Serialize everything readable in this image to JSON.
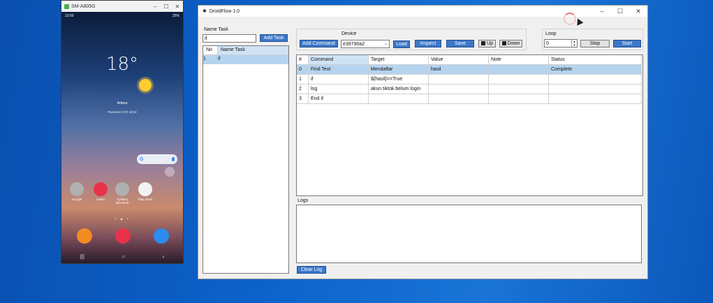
{
  "phone": {
    "window_title": "SM-A805G",
    "status_left": "23:00",
    "status_right": "25%",
    "clock": "18°",
    "city": "Adana",
    "date": "Pazartesi 07/3 18:02",
    "google_glyph": "G",
    "apps": [
      {
        "label": "Google",
        "color": "#b0b0b0"
      },
      {
        "label": "Galeri",
        "color": "#e8334a"
      },
      {
        "label": "Aplikasi Microsoft",
        "color": "#b0b0b0"
      },
      {
        "label": "Play Store",
        "color": "#f2f2f2"
      }
    ],
    "dock_colors": [
      "#f28b22",
      "#e8334a",
      "#2d8cf0"
    ],
    "nav": {
      "recent": "|||",
      "home": "○",
      "back": "‹"
    }
  },
  "app": {
    "title": "DroidFlow 1.0",
    "name_task_label": "Name Task",
    "task_input_value": "if",
    "add_task_button": "Add Task",
    "task_grid": {
      "headers": [
        "No",
        "Name Task"
      ],
      "rows": [
        [
          "1",
          "if"
        ]
      ]
    },
    "device_label": "Device",
    "add_command_button": "Add Command",
    "device_select": "e39790a2",
    "load_button": "Load",
    "inspect_button": "Inspect",
    "save_button": "Save",
    "up_button": "Up",
    "down_button": "Down",
    "loop_label": "Loop",
    "loop_value": "0",
    "stop_button": "Stop",
    "start_button": "Start",
    "command_grid": {
      "headers": [
        "#",
        "Command",
        "Target",
        "Value",
        "Note",
        "Status"
      ],
      "rows": [
        [
          "0",
          "Find Text",
          "Mendaftar",
          "hasil",
          "",
          "Complete"
        ],
        [
          "1",
          "if",
          "${hasil}==True",
          "",
          "",
          ""
        ],
        [
          "2",
          "log",
          "akun tiktok belum login",
          "",
          "",
          ""
        ],
        [
          "3",
          "End if",
          "",
          "",
          "",
          ""
        ]
      ]
    },
    "logs_label": "Logs",
    "clear_log_button": "Clear Log"
  },
  "colors": {
    "accent_button": "#3c78c8",
    "selection": "#b5d4ef"
  }
}
